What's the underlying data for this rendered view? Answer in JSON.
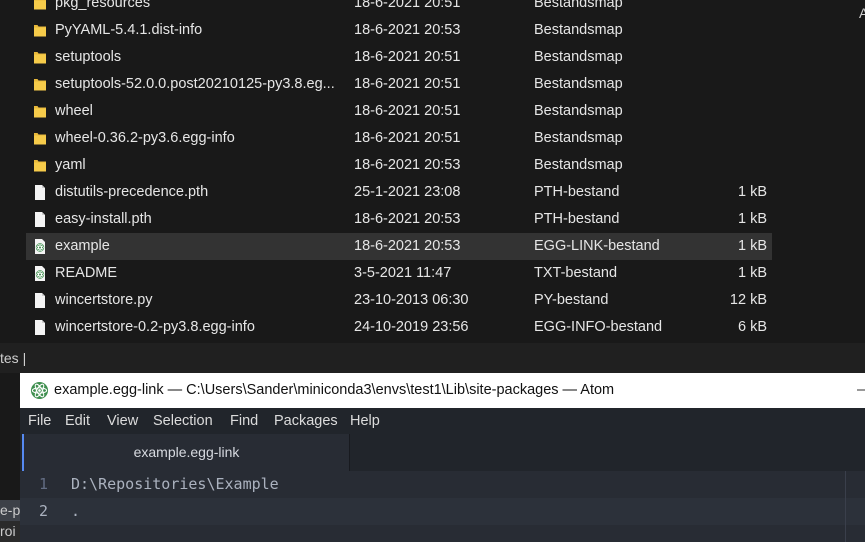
{
  "explorer": {
    "right_edge_text": "A",
    "files": [
      {
        "name": "pkg_resources",
        "date": "18-6-2021 20:51",
        "type": "Bestandsmap",
        "size": "",
        "icon": "folder-icon"
      },
      {
        "name": "PyYAML-5.4.1.dist-info",
        "date": "18-6-2021 20:53",
        "type": "Bestandsmap",
        "size": "",
        "icon": "folder-icon"
      },
      {
        "name": "setuptools",
        "date": "18-6-2021 20:51",
        "type": "Bestandsmap",
        "size": "",
        "icon": "folder-icon"
      },
      {
        "name": "setuptools-52.0.0.post20210125-py3.8.eg...",
        "date": "18-6-2021 20:51",
        "type": "Bestandsmap",
        "size": "",
        "icon": "folder-icon"
      },
      {
        "name": "wheel",
        "date": "18-6-2021 20:51",
        "type": "Bestandsmap",
        "size": "",
        "icon": "folder-icon"
      },
      {
        "name": "wheel-0.36.2-py3.6.egg-info",
        "date": "18-6-2021 20:51",
        "type": "Bestandsmap",
        "size": "",
        "icon": "folder-icon"
      },
      {
        "name": "yaml",
        "date": "18-6-2021 20:53",
        "type": "Bestandsmap",
        "size": "",
        "icon": "folder-icon"
      },
      {
        "name": "distutils-precedence.pth",
        "date": "25-1-2021 23:08",
        "type": "PTH-bestand",
        "size": "1 kB",
        "icon": "file-icon"
      },
      {
        "name": "easy-install.pth",
        "date": "18-6-2021 20:53",
        "type": "PTH-bestand",
        "size": "1 kB",
        "icon": "file-icon"
      },
      {
        "name": "example",
        "date": "18-6-2021 20:53",
        "type": "EGG-LINK-bestand",
        "size": "1 kB",
        "icon": "atom-file-icon",
        "selected": true
      },
      {
        "name": "README",
        "date": "3-5-2021 11:47",
        "type": "TXT-bestand",
        "size": "1 kB",
        "icon": "atom-file-icon"
      },
      {
        "name": "wincertstore.py",
        "date": "23-10-2013 06:30",
        "type": "PY-bestand",
        "size": "12 kB",
        "icon": "file-icon"
      },
      {
        "name": "wincertstore-0.2-py3.8.egg-info",
        "date": "24-10-2019 23:56",
        "type": "EGG-INFO-bestand",
        "size": "6 kB",
        "icon": "file-icon"
      }
    ]
  },
  "strip": {
    "left_text": "tes  |"
  },
  "left_peek": [
    "e-p",
    "roi"
  ],
  "atom": {
    "title": "example.egg-link — C:\\Users\\Sander\\miniconda3\\envs\\test1\\Lib\\site-packages — Atom",
    "menu": [
      "File",
      "Edit",
      "View",
      "Selection",
      "Find",
      "Packages",
      "Help"
    ],
    "tab_label": "example.egg-link",
    "lines": [
      {
        "number": "1",
        "text": "D:\\Repositories\\Example"
      },
      {
        "number": "2",
        "text": "."
      }
    ],
    "colors": {
      "accent": "#568af2",
      "editor_bg": "#282c34",
      "text": "#abb2bf"
    }
  }
}
